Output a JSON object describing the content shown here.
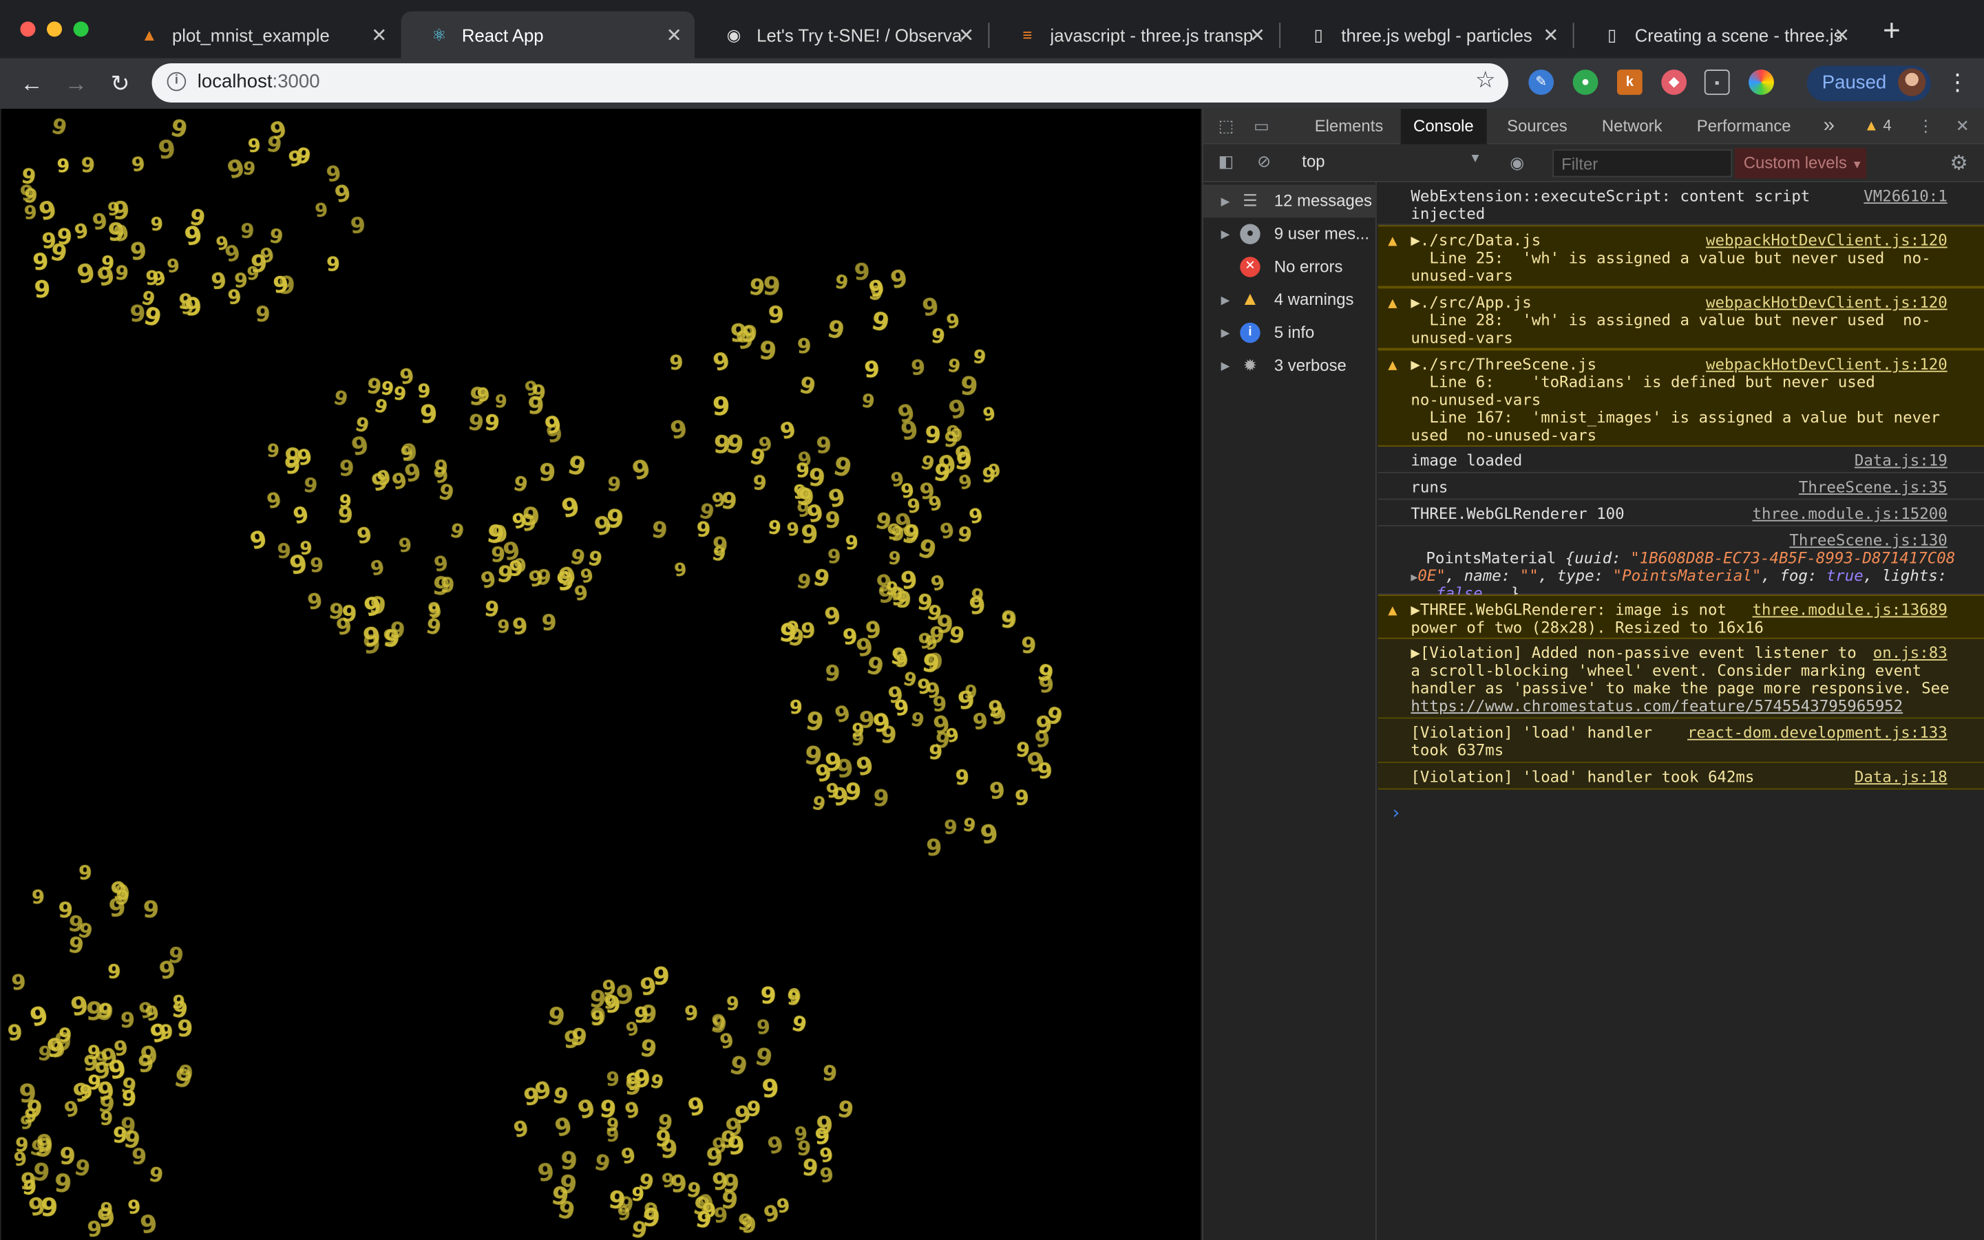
{
  "browser": {
    "tabs": [
      {
        "title": "plot_mnist_example",
        "icon": "notebook-icon"
      },
      {
        "title": "React App",
        "icon": "react-icon"
      },
      {
        "title": "Let's Try t-SNE! / Observa",
        "icon": "observable-icon"
      },
      {
        "title": "javascript - three.js transp",
        "icon": "stackoverflow-icon"
      },
      {
        "title": "three.js webgl - particles",
        "icon": "document-icon"
      },
      {
        "title": "Creating a scene - three.js",
        "icon": "document-icon"
      }
    ],
    "active_tab_index": 1,
    "url_host": "localhost",
    "url_port": ":3000",
    "profile_status": "Paused"
  },
  "canvas": {
    "glyph": "9"
  },
  "devtools": {
    "tabs": [
      "Elements",
      "Console",
      "Sources",
      "Network",
      "Performance"
    ],
    "active_tab": "Console",
    "more_tabs": "»",
    "warning_count": "4",
    "context": "top",
    "filter_placeholder": "Filter",
    "levels": "Custom levels",
    "sidebar": [
      {
        "label": "12 messages",
        "icon": "list-icon"
      },
      {
        "label": "9 user mes...",
        "icon": "user-icon"
      },
      {
        "label": "No errors",
        "icon": "error-icon"
      },
      {
        "label": "4 warnings",
        "icon": "warning-icon"
      },
      {
        "label": "5 info",
        "icon": "info-icon"
      },
      {
        "label": "3 verbose",
        "icon": "verbose-icon"
      }
    ],
    "messages": [
      {
        "type": "log",
        "lines": [
          "WebExtension::executeScript: content script",
          "injected"
        ],
        "source": "VM26610:1"
      },
      {
        "type": "warn",
        "lines": [
          "▶./src/Data.js",
          "  Line 25:  'wh' is assigned a value but never used  no-",
          "unused-vars"
        ],
        "source": "webpackHotDevClient.js:120"
      },
      {
        "type": "warn",
        "lines": [
          "▶./src/App.js",
          "  Line 28:  'wh' is assigned a value but never used  no-",
          "unused-vars"
        ],
        "source": "webpackHotDevClient.js:120"
      },
      {
        "type": "warn",
        "lines": [
          "▶./src/ThreeScene.js",
          "  Line 6:    'toRadians' is defined but never used",
          "no-unused-vars",
          "  Line 167:  'mnist_images' is assigned a value but never",
          "used  no-unused-vars"
        ],
        "source": "webpackHotDevClient.js:120"
      },
      {
        "type": "log",
        "lines": [
          "image loaded"
        ],
        "source": "Data.js:19"
      },
      {
        "type": "log",
        "lines": [
          "runs"
        ],
        "source": "ThreeScene.js:35"
      },
      {
        "type": "log",
        "lines": [
          "THREE.WebGLRenderer 100"
        ],
        "source": "three.module.js:15200"
      },
      {
        "type": "object",
        "source": "ThreeScene.js:130",
        "object_name": "PointsMaterial",
        "uuid": "\"1B608D8B-EC73-4B5F-8993-D871417C08",
        "uuid_tail": "0E\"",
        "name_val": "\"\"",
        "type_val": "\"PointsMaterial\"",
        "fog_val": "true",
        "false_val": "false"
      },
      {
        "type": "warn",
        "lines": [
          "▶THREE.WebGLRenderer: image is not",
          "power of two (28x28). Resized to 16x16"
        ],
        "source": "three.module.js:13689"
      },
      {
        "type": "log",
        "lines": [
          "▶[Violation] Added non-passive event listener to",
          "a scroll-blocking 'wheel' event. Consider marking event",
          "handler as 'passive' to make the page more responsive. See"
        ],
        "link": "https://www.chromestatus.com/feature/5745543795965952",
        "source": "on.js:83"
      },
      {
        "type": "log",
        "lines": [
          "[Violation] 'load' handler",
          "took 637ms"
        ],
        "source": "react-dom.development.js:133"
      },
      {
        "type": "log",
        "lines": [
          "[Violation] 'load' handler took 642ms"
        ],
        "source": "Data.js:18"
      }
    ],
    "prompt": "›"
  },
  "colors": {
    "digit": "#d4c23c",
    "warning": "#f3b83b",
    "error": "#e8453c",
    "info": "#3b78e7"
  }
}
